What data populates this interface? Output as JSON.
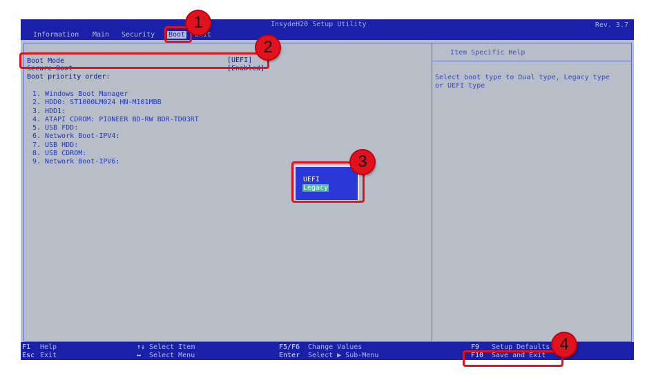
{
  "title": "InsydeH20 Setup Utility",
  "revision": "Rev. 3.7",
  "menu": [
    {
      "label": "Information",
      "active": false
    },
    {
      "label": "Main",
      "active": false
    },
    {
      "label": "Security",
      "active": false
    },
    {
      "label": "Boot",
      "active": true
    },
    {
      "label": "Exit",
      "active": false
    }
  ],
  "options": [
    {
      "label": "Boot Mode",
      "value": "[UEFI]"
    },
    {
      "label": "Secure Boot",
      "value": "[Enabled]"
    }
  ],
  "boot_priority_label": "Boot priority order:",
  "boot_priority": [
    "1.  Windows Boot Manager",
    "2.  HDD0: ST1000LM024 HN-M101MBB",
    "3.  HDD1:",
    "4.  ATAPI CDROM: PIONEER BD-RW  BDR-TD03RT",
    "5.  USB FDD:",
    "6.  Network Boot-IPV4:",
    "7.  USB HDD:",
    "8.  USB CDROM:",
    "9.  Network Boot-IPV6:"
  ],
  "help": {
    "title": "Item Specific Help",
    "text": "Select boot type to Dual type, Legacy type or UEFI type"
  },
  "popup": {
    "options": [
      "UEFI",
      "Legacy"
    ],
    "selected": "Legacy"
  },
  "footer": {
    "f1_key": "F1",
    "f1_desc": "Help",
    "esc_key": "Esc",
    "esc_desc": "Exit",
    "updown_key": "↑↓",
    "updown_desc": "Select Item",
    "leftright_key": "↔",
    "leftright_desc": "Select Menu",
    "f5f6_key": "F5/F6",
    "f5f6_desc": "Change Values",
    "enter_key": "Enter",
    "enter_desc": "Select ▶ Sub-Menu",
    "f9_key": "F9",
    "f9_desc": "Setup Defaults",
    "f10_key": "F10",
    "f10_desc": "Save and Exit"
  },
  "annotations": [
    "1",
    "2",
    "3",
    "4"
  ],
  "colors": {
    "bios_blue": "#1a20a8",
    "panel_gray": "#b7bec8",
    "highlight_red": "#e0121e",
    "popup_blue": "#2a38d8",
    "selected_teal": "#4cb6a0"
  }
}
